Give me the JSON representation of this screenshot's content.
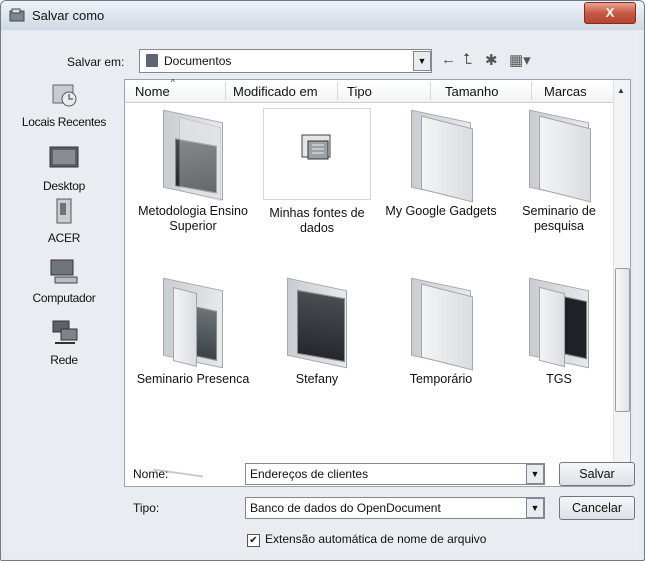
{
  "window": {
    "title": "Salvar como",
    "close": "X"
  },
  "toolbar": {
    "save_in_label": "Salvar em:",
    "current_folder": "Documentos",
    "back_glyph": "←",
    "up_glyph": "⮤",
    "new_folder_glyph": "✱",
    "views_glyph": "▦▾"
  },
  "places": [
    {
      "label": "Locais Recentes",
      "icon": "recent-places-icon"
    },
    {
      "label": "Desktop",
      "icon": "desktop-icon"
    },
    {
      "label": "ACER",
      "icon": "user-folder-icon"
    },
    {
      "label": "Computador",
      "icon": "computer-icon"
    },
    {
      "label": "Rede",
      "icon": "network-icon"
    }
  ],
  "columns": [
    "Nome",
    "Modificado em",
    "Tipo",
    "Tamanho",
    "Marcas"
  ],
  "items": [
    {
      "name": "Metodologia Ensino Superior",
      "type": "photo-folder"
    },
    {
      "name": "Minhas fontes de dados",
      "type": "datasource"
    },
    {
      "name": "My Google Gadgets",
      "type": "folder"
    },
    {
      "name": "Seminario de pesquisa",
      "type": "folder"
    },
    {
      "name": "Seminario Presenca",
      "type": "photo-folder"
    },
    {
      "name": "Stefany",
      "type": "photo-folder"
    },
    {
      "name": "Temporário",
      "type": "folder"
    },
    {
      "name": "TGS",
      "type": "photo-folder"
    }
  ],
  "footer": {
    "name_label": "Nome:",
    "name_value": "Endereços de clientes",
    "type_label": "Tipo:",
    "type_value": "Banco de dados do OpenDocument",
    "save_button": "Salvar",
    "cancel_button": "Cancelar",
    "auto_ext_label": "Extensão automática de nome de arquivo",
    "auto_ext_checked": true
  }
}
